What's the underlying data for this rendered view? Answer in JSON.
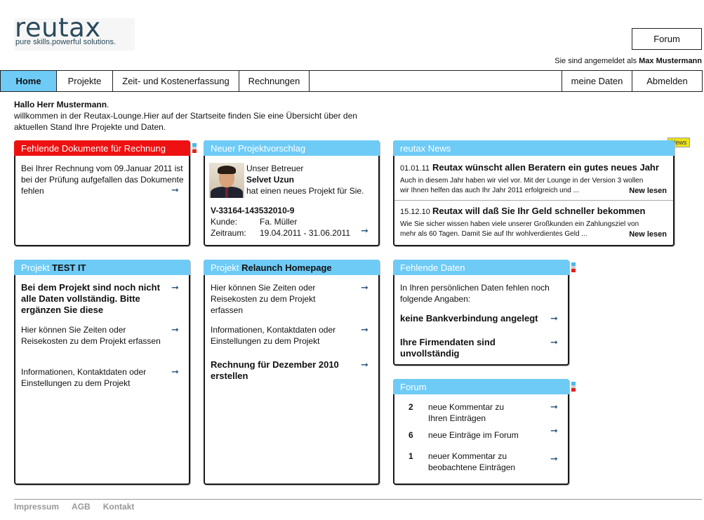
{
  "logo": {
    "word": "reutax",
    "tagline": "pure skills.powerful solutions."
  },
  "header": {
    "forum_button": "Forum",
    "login_prefix": "Sie sind angemeldet als",
    "login_user": "Max Mustermann"
  },
  "nav": {
    "home": "Home",
    "projekte": "Projekte",
    "zeit": "Zeit- und Kostenerfassung",
    "rechnungen": "Rechnungen",
    "meine_daten": "meine Daten",
    "abmelden": "Abmelden"
  },
  "intro": {
    "hello": "Hallo Herr Mustermann",
    "hello_end": ".",
    "line": "willkommen in der Reutax-Lounge.Hier auf der Startseite finden Sie eine Übersicht über den aktuellen Stand Ihre Projekte und Daten."
  },
  "fehlende_dokumente": {
    "title": "Fehlende Dokumente für Rechnung",
    "text": "Bei Ihrer Rechnung vom 09.Januar 2011 ist bei der Prüfung aufgefallen das Dokumente fehlen"
  },
  "projektvorschlag": {
    "title": "Neuer Projektvorschlag",
    "betreuer_label": "Unser Betreuer",
    "betreuer_name": "Selvet Uzun",
    "betreuer_text": "hat einen neues Projekt für Sie.",
    "project_id": "V-33164-143532010-9",
    "kunde_label": "Kunde:",
    "kunde_value": "Fa. Müller",
    "zeitraum_label": "Zeitraum:",
    "zeitraum_value": "19.04.2011 - 31.06.2011"
  },
  "news": {
    "badge": "News",
    "title": "reutax News",
    "items": [
      {
        "date": "01.01.11",
        "headline": "Reutax wünscht allen Beratern ein gutes neues Jahr",
        "text1": "Auch in diesem Jahr haben wir viel vor. Mit der Lounge in der Version 3 wollen",
        "text2": "wir Ihnen helfen das auch Ihr Jahr 2011 erfolgreich und ...",
        "more": "New lesen"
      },
      {
        "date": "15.12.10",
        "headline": "Reutax will daß Sie Ihr Geld schneller bekommen",
        "text1": "Wie Sie sicher wissen haben viele unserer Großkunden ein Zahlungsziel von",
        "text2": "mehr als 60 Tagen. Damit Sie auf Ihr wohlverdientes Geld ...",
        "more": "New lesen"
      }
    ]
  },
  "projekt_test": {
    "title_prefix": "Projekt ",
    "title_name": "TEST IT",
    "warning": "Bei dem Projekt sind noch nicht alle Daten vollständig. Bitte ergänzen Sie diese",
    "zeiten": "Hier können Sie Zeiten oder Reisekosten zu dem Projekt erfassen",
    "info": "Informationen, Kontaktdaten oder Einstellungen zu dem Projekt"
  },
  "projekt_relaunch": {
    "title_prefix": "Projekt ",
    "title_name": "Relaunch Homepage",
    "zeiten": "Hier können Sie Zeiten oder Reisekosten zu dem Projekt erfassen",
    "info": "Informationen, Kontaktdaten oder Einstellungen zu dem Projekt",
    "rechnung": "Rechnung für Dezember 2010 erstellen"
  },
  "fehlende_daten": {
    "title": "Fehlende Daten",
    "intro": "In Ihren persönlichen Daten fehlen noch folgende Angaben:",
    "item1": "keine Bankverbindung angelegt",
    "item2": "Ihre Firmendaten sind unvollständig"
  },
  "forum_box": {
    "title": "Forum",
    "items": [
      {
        "count": "2",
        "text": "neue Kommentar zu Ihren Einträgen"
      },
      {
        "count": "6",
        "text": "neue Einträge im Forum"
      },
      {
        "count": "1",
        "text": "neuer Kommentar zu beobachtene Einträgen"
      }
    ]
  },
  "footer": {
    "impressum": "Impressum",
    "agb": "AGB",
    "kontakt": "Kontakt"
  },
  "colors": {
    "accent_blue": "#6ecbf6",
    "alert_red": "#ee1111",
    "arrow_blue": "#244e78",
    "news_badge": "#ece21a"
  },
  "icons": {
    "arrow": "arrow-right-icon",
    "flag": "flag-icon"
  }
}
